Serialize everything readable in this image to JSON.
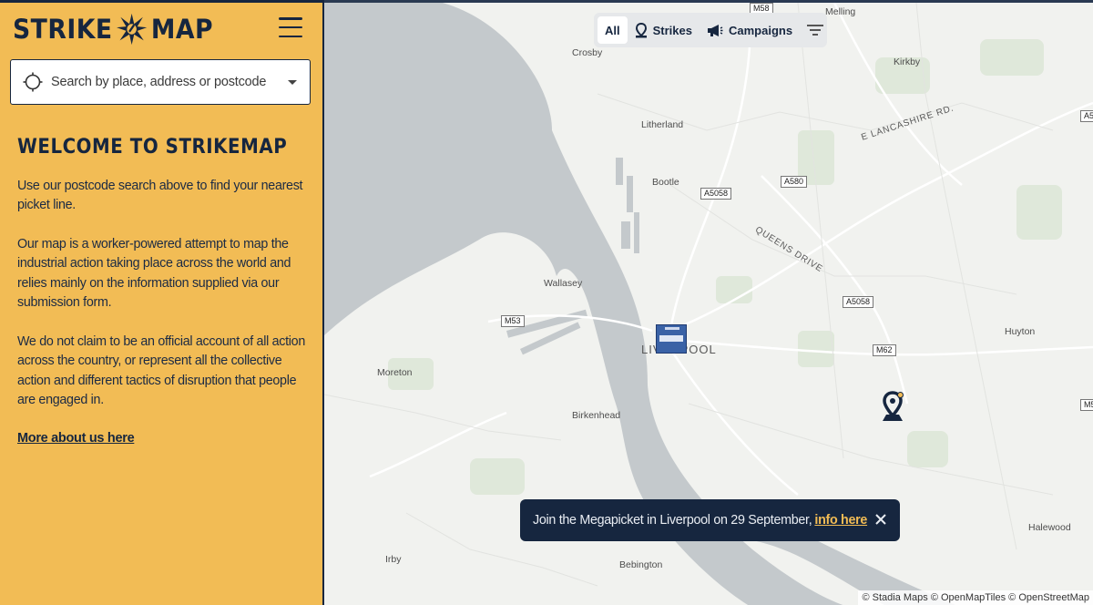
{
  "app": {
    "logo_left": "STRIKE",
    "logo_right": "MAP"
  },
  "search": {
    "placeholder": "Search by place, address or postcode"
  },
  "sidebar": {
    "heading": "WELCOME TO STRIKEMAP",
    "paragraph_1": "Use our postcode search above to find your nearest picket line.",
    "paragraph_2": "Our map is a worker-powered attempt to map the industrial action taking place across the world and relies mainly on the information supplied via our submission form.",
    "paragraph_3": "We do not claim to be an official account of all action across the country, or represent all the collective action and different tactics of disruption that people are engaged in.",
    "more_link": "More about us here"
  },
  "filters": {
    "all": "All",
    "strikes": "Strikes",
    "campaigns": "Campaigns",
    "active": "All"
  },
  "map": {
    "places": {
      "melling": "Melling",
      "crosby": "Crosby",
      "kirkby": "Kirkby",
      "litherland": "Litherland",
      "bootle": "Bootle",
      "wallasey": "Wallasey",
      "liverpool": "LIVERPOOL",
      "moreton": "Moreton",
      "birkenhead": "Birkenhead",
      "huyton": "Huyton",
      "halewood": "Halewood",
      "irby": "Irby",
      "bebington": "Bebington"
    },
    "roads": {
      "e_lancashire": "E LANCASHIRE RD.",
      "queens_drive": "QUEENS DRIVE"
    },
    "shields": {
      "m58": "M58",
      "a580": "A580",
      "a5058_north": "A5058",
      "a5058_east": "A5058",
      "m53": "M53",
      "m62": "M62",
      "m5_right": "M5",
      "a5_right": "A5"
    }
  },
  "toast": {
    "message": "Join the Megapicket in Liverpool on 29 September,",
    "link": "info here"
  },
  "attribution": "© Stadia Maps © OpenMapTiles © OpenStreetMap",
  "colors": {
    "sidebar_bg": "#f2bc55",
    "navy": "#16263f",
    "water": "#c4c9cc",
    "land": "#f1f2ef",
    "park": "#dfe8da"
  }
}
